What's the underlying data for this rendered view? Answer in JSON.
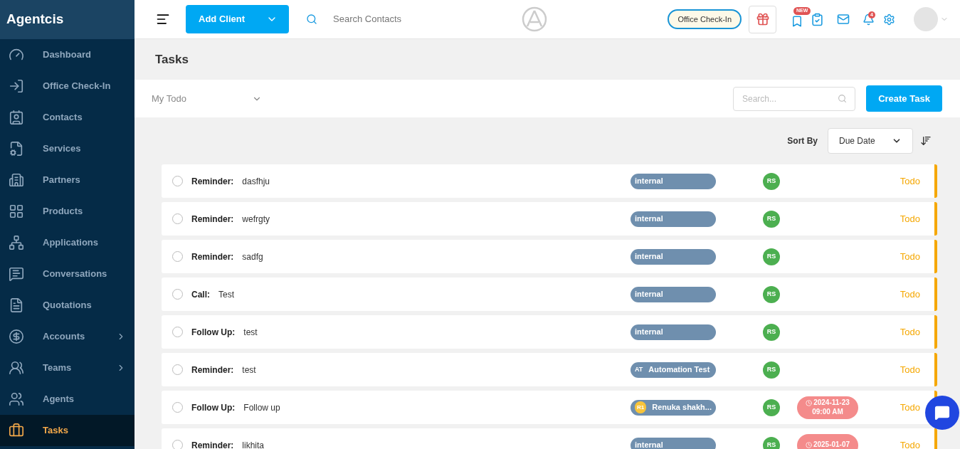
{
  "brand": "Agentcis",
  "sidebar": {
    "items": [
      {
        "label": "Dashboard",
        "selected": false,
        "has_submenu": false
      },
      {
        "label": "Office Check-In",
        "selected": false,
        "has_submenu": false
      },
      {
        "label": "Contacts",
        "selected": false,
        "has_submenu": false
      },
      {
        "label": "Services",
        "selected": false,
        "has_submenu": false
      },
      {
        "label": "Partners",
        "selected": false,
        "has_submenu": false
      },
      {
        "label": "Products",
        "selected": false,
        "has_submenu": false
      },
      {
        "label": "Applications",
        "selected": false,
        "has_submenu": false
      },
      {
        "label": "Conversations",
        "selected": false,
        "has_submenu": false
      },
      {
        "label": "Quotations",
        "selected": false,
        "has_submenu": false
      },
      {
        "label": "Accounts",
        "selected": false,
        "has_submenu": true
      },
      {
        "label": "Teams",
        "selected": false,
        "has_submenu": true
      },
      {
        "label": "Agents",
        "selected": false,
        "has_submenu": false
      },
      {
        "label": "Tasks",
        "selected": true,
        "has_submenu": false
      }
    ]
  },
  "header": {
    "add_button": "Add Client",
    "search_placeholder": "Search Contacts",
    "checkin_button": "Office Check-In",
    "new_badge": "NEW",
    "notification_count": "4"
  },
  "page_title": "Tasks",
  "filter": {
    "value": "My Todo"
  },
  "search": {
    "placeholder": "Search..."
  },
  "create_button": "Create Task",
  "sort": {
    "label": "Sort By",
    "value": "Due Date"
  },
  "tasks": [
    {
      "type": "Reminder:",
      "title": "dasfhju",
      "tag": {
        "kind": "plain",
        "label": "internal"
      },
      "assignee": "RS",
      "status": "Todo",
      "done": false
    },
    {
      "type": "Reminder:",
      "title": "wefrgty",
      "tag": {
        "kind": "plain",
        "label": "internal"
      },
      "assignee": "RS",
      "status": "Todo",
      "done": false
    },
    {
      "type": "Reminder:",
      "title": "sadfg",
      "tag": {
        "kind": "plain",
        "label": "internal"
      },
      "assignee": "RS",
      "status": "Todo",
      "done": false
    },
    {
      "type": "Call:",
      "title": "Test",
      "tag": {
        "kind": "plain",
        "label": "internal"
      },
      "assignee": "RS",
      "status": "Todo",
      "done": false
    },
    {
      "type": "Follow Up:",
      "title": "test",
      "tag": {
        "kind": "plain",
        "label": "internal"
      },
      "assignee": "RS",
      "status": "Todo",
      "done": false
    },
    {
      "type": "Reminder:",
      "title": "test",
      "tag": {
        "kind": "initials",
        "initials": "AT",
        "label": "Automation Test"
      },
      "assignee": "RS",
      "status": "Todo",
      "done": false
    },
    {
      "type": "Follow Up:",
      "title": "Follow up",
      "tag": {
        "kind": "avatar",
        "initials": "R1",
        "color": "#f8c43a",
        "label": "Renuka shakh..."
      },
      "assignee": "RS",
      "due": {
        "date": "2024-11-23",
        "time": "09:00 AM"
      },
      "status": "Todo",
      "done": false
    },
    {
      "type": "Reminder:",
      "title": "likhita",
      "tag": {
        "kind": "plain",
        "label": "internal"
      },
      "assignee": "RS",
      "due": {
        "date": "2025-01-07"
      },
      "status": "Todo",
      "done": false
    }
  ]
}
